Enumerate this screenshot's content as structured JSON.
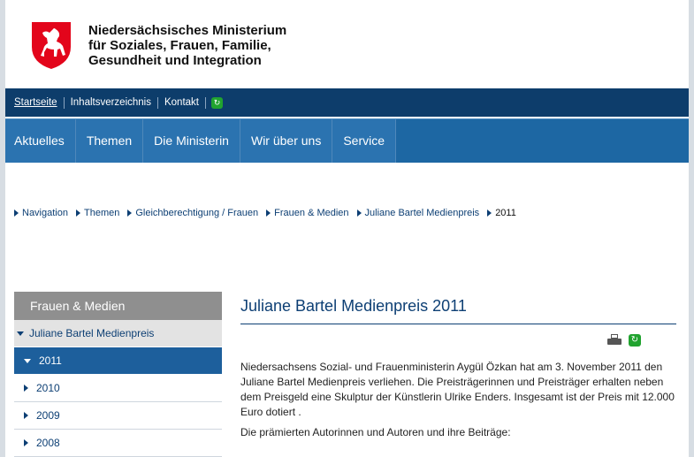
{
  "header": {
    "ministry_line1": "Niedersächsisches Ministerium",
    "ministry_line2": "für Soziales, Frauen, Familie,",
    "ministry_line3": "Gesundheit und Integration"
  },
  "utilbar": {
    "links": [
      "Startseite",
      "Inhaltsverzeichnis",
      "Kontakt"
    ]
  },
  "mainnav": {
    "items": [
      "Aktuelles",
      "Themen",
      "Die Ministerin",
      "Wir über uns",
      "Service"
    ]
  },
  "breadcrumb": {
    "items": [
      "Navigation",
      "Themen",
      "Gleichberechtigung / Frauen",
      "Frauen & Medien",
      "Juliane Bartel Medienpreis",
      "2011"
    ]
  },
  "sidebar": {
    "title": "Frauen & Medien",
    "parent": "Juliane Bartel Medienpreis",
    "current": "2011",
    "items": [
      "2010",
      "2009",
      "2008"
    ]
  },
  "content": {
    "title": "Juliane Bartel Medienpreis 2011",
    "paragraph1": "Niedersachsens Sozial- und Frauenministerin Aygül Özkan hat am 3. November 2011 den Juliane Bartel Medienpreis verliehen. Die Preisträgerinnen und Preisträger erhalten neben dem Preisgeld eine Skulptur der Künstlerin Ulrike Enders. Insgesamt ist der Preis mit 12.000 Euro dotiert .",
    "paragraph2": "Die prämierten Autorinnen und Autoren und ihre Beiträge:"
  },
  "colors": {
    "utilbar": "#0d3d6b",
    "mainnav": "#1f6aa7",
    "link": "#0d3f74",
    "sidebar_current": "#1d5f9c",
    "rss": "#21a32f"
  },
  "icons": [
    "horse-logo-icon",
    "rss-icon",
    "print-icon"
  ]
}
